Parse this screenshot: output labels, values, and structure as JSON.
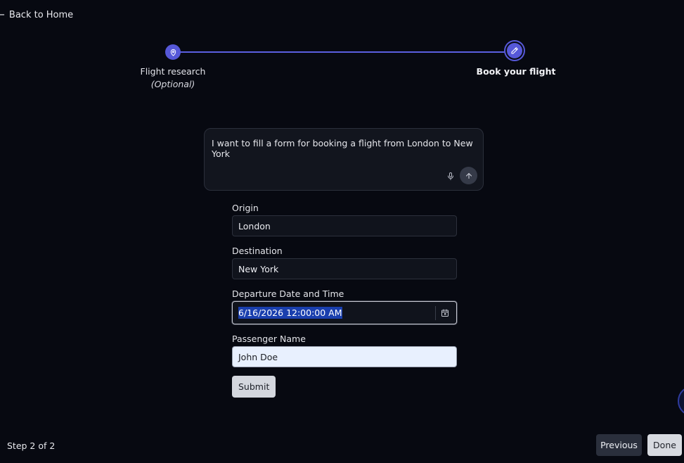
{
  "nav": {
    "back_label": "Back to Home"
  },
  "stepper": {
    "steps": [
      {
        "label": "Flight research",
        "sublabel": "(Optional)"
      },
      {
        "label": "Book your flight"
      }
    ],
    "accent_color": "#5658d8"
  },
  "prompt": {
    "text": "I want to fill a form for booking a flight from London to New York",
    "mic_icon": "microphone-icon",
    "send_icon": "arrow-up-icon"
  },
  "form": {
    "origin_label": "Origin",
    "origin_value": "London",
    "destination_label": "Destination",
    "destination_value": "New York",
    "departure_label": "Departure Date and Time",
    "departure_value": "6/16/2026 12:00:00 AM",
    "passenger_label": "Passenger Name",
    "passenger_value": "John Doe",
    "submit_label": "Submit"
  },
  "footer": {
    "step_text": "Step 2 of 2",
    "previous_label": "Previous",
    "done_label": "Done"
  }
}
